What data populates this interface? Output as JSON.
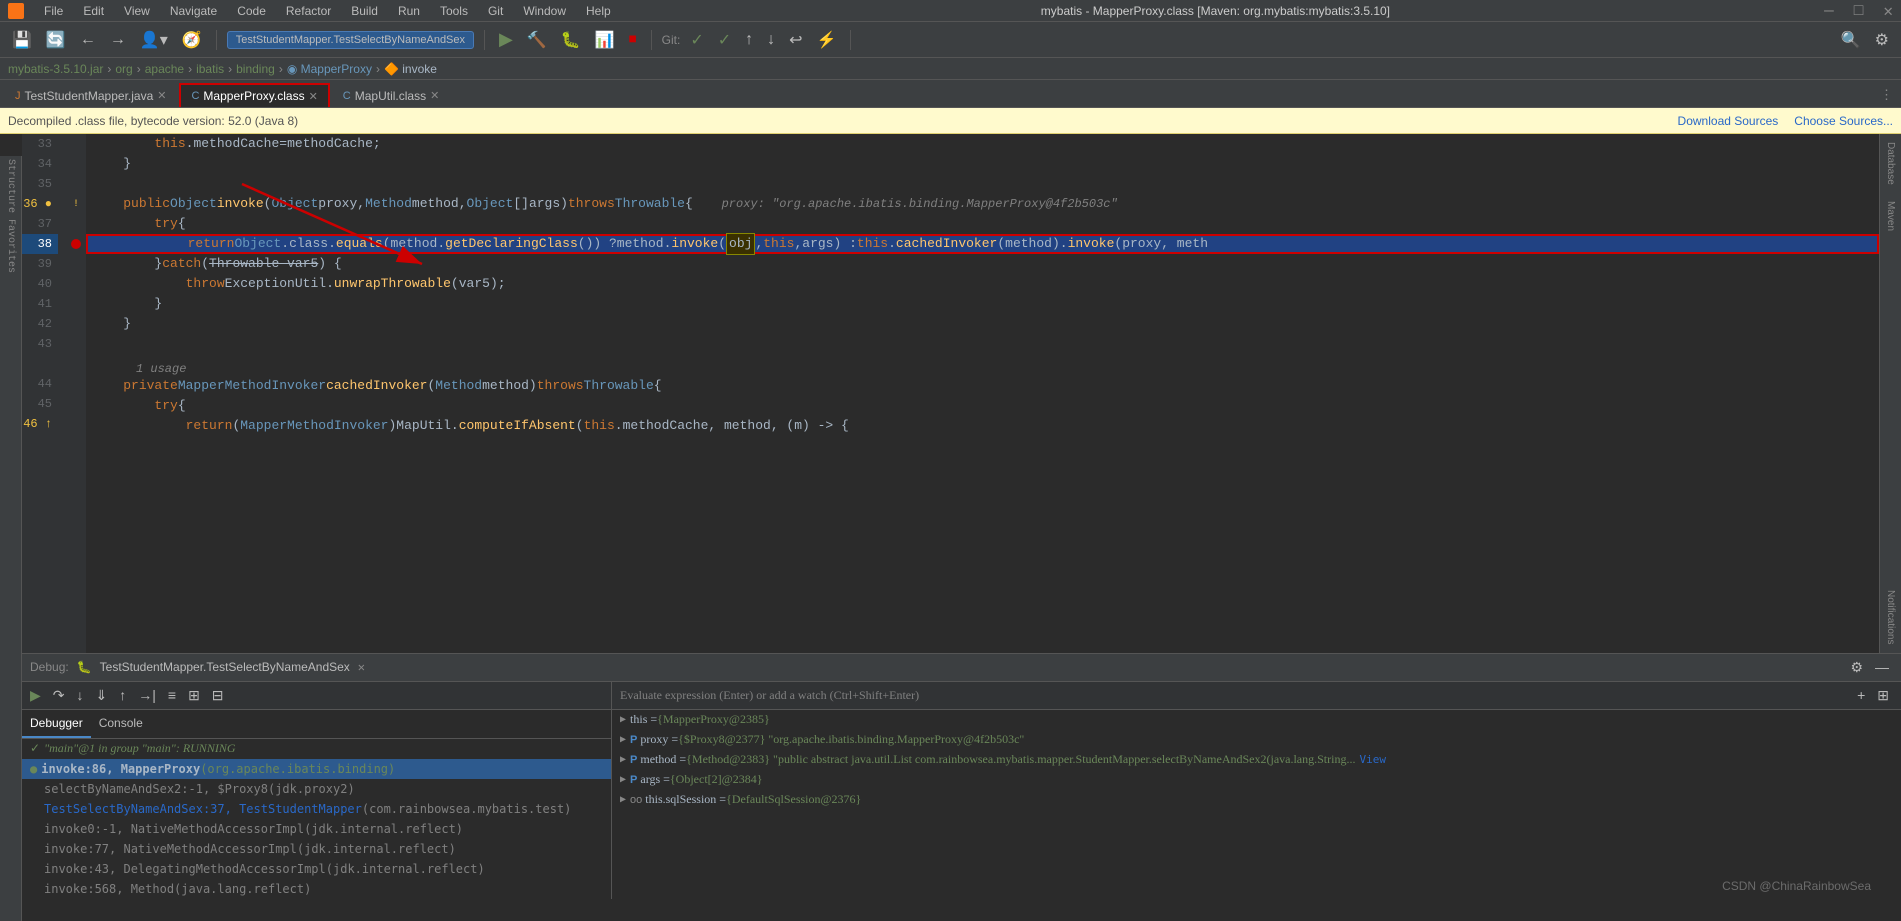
{
  "window": {
    "title": "mybatis - MapperProxy.class [Maven: org.mybatis:mybatis:3.5.10]"
  },
  "menu": {
    "items": [
      "File",
      "Edit",
      "View",
      "Navigate",
      "Code",
      "Refactor",
      "Build",
      "Run",
      "Tools",
      "Git",
      "Window",
      "Help"
    ]
  },
  "toolbar": {
    "run_config": "TestStudentMapper.TestSelectByNameAndSex",
    "git_label": "Git:"
  },
  "breadcrumb": {
    "items": [
      "mybatis-3.5.10.jar",
      "org",
      "apache",
      "ibatis",
      "binding",
      "MapperProxy",
      "invoke"
    ]
  },
  "tabs": [
    {
      "name": "TestStudentMapper.java",
      "type": "java",
      "active": false
    },
    {
      "name": "MapperProxy.class",
      "type": "class",
      "active": true
    },
    {
      "name": "MapUtil.class",
      "type": "class",
      "active": false
    }
  ],
  "info_bar": {
    "text": "Decompiled .class file, bytecode version: 52.0 (Java 8)",
    "download_sources": "Download Sources",
    "choose_sources": "Choose Sources..."
  },
  "code": {
    "lines": [
      {
        "num": 33,
        "content": "        this.methodCache = methodCache;"
      },
      {
        "num": 34,
        "content": "    }"
      },
      {
        "num": 35,
        "content": ""
      },
      {
        "num": 36,
        "content": "    public Object invoke(Object proxy, Method method, Object[] args) throws Throwable {",
        "has_breakpoint": true,
        "inline_hint": "proxy: \"org.apache.ibatis.binding.MapperProxy@4f2b503c\""
      },
      {
        "num": 37,
        "content": "        try {"
      },
      {
        "num": 38,
        "content": "            return Object.class.equals(method.getDeclaringClass()) ? method.invoke(obj, this, args) : this.cachedInvoker(method).invoke(proxy, meth",
        "highlighted": true,
        "has_breakpoint_dot": true
      },
      {
        "num": 39,
        "content": "        } catch (Throwable var5) {"
      },
      {
        "num": 40,
        "content": "            throw ExceptionUtil.unwrapThrowable(var5);"
      },
      {
        "num": 41,
        "content": "        }"
      },
      {
        "num": 42,
        "content": "    }"
      },
      {
        "num": 43,
        "content": ""
      },
      {
        "num": "usage",
        "content": "1 usage"
      },
      {
        "num": 44,
        "content": "    private MapperMethodInvoker cachedInvoker(Method method) throws Throwable {"
      },
      {
        "num": 45,
        "content": "        try {"
      },
      {
        "num": 46,
        "content": "            return (MapperMethodInvoker)MapUtil.computeIfAbsent(this.methodCache, method, (m) -> {",
        "partial": true
      }
    ]
  },
  "debug": {
    "title": "Debug:",
    "session_tab": "TestStudentMapper.TestSelectByNameAndSex",
    "tabs": [
      "Debugger",
      "Console"
    ],
    "running_status": "\"main\"@1 in group \"main\": RUNNING",
    "stack_frames": [
      {
        "label": "invoke:86, MapperProxy (org.apache.ibatis.binding)",
        "selected": true,
        "has_green_dot": true
      },
      {
        "label": "selectByNameAndSex2:-1, $Proxy8 (jdk.proxy2)",
        "gray": true
      },
      {
        "label": "TestSelectByNameAndSex:37, TestStudentMapper (com.rainbowsea.mybatis.test)",
        "is_link": true
      },
      {
        "label": "invoke0:-1, NativeMethodAccessorImpl (jdk.internal.reflect)",
        "gray": true
      },
      {
        "label": "invoke:77, NativeMethodAccessorImpl (jdk.internal.reflect)",
        "gray": true
      },
      {
        "label": "invoke:43, DelegatingMethodAccessorImpl (jdk.internal.reflect)",
        "gray": true
      },
      {
        "label": "invoke:568, Method (java.lang.reflect)",
        "gray": true
      }
    ],
    "evaluate_placeholder": "Evaluate expression (Enter) or add a watch (Ctrl+Shift+Enter)",
    "watches": [
      {
        "name": "this",
        "value": "= {MapperProxy@2385}",
        "icon": "expand"
      },
      {
        "name": "proxy",
        "value": "= {$Proxy8@2377} \"org.apache.ibatis.binding.MapperProxy@4f2b503c\"",
        "icon": "p"
      },
      {
        "name": "method",
        "value": "= {Method@2383} \"public abstract java.util.List com.rainbowsea.mybatis.mapper.StudentMapper.selectByNameAndSex2(java.lang.String...",
        "icon": "p",
        "has_view": true
      },
      {
        "name": "args",
        "value": "= {Object[2]@2384}",
        "icon": "p"
      },
      {
        "name": "this.sqlSession",
        "value": "= {DefaultSqlSession@2376}",
        "icon": "oo"
      }
    ]
  },
  "watermark": "CSDN @ChinaRainbowSea",
  "right_sidebar": {
    "items": [
      "Database",
      "Maven",
      "Notifications"
    ]
  }
}
